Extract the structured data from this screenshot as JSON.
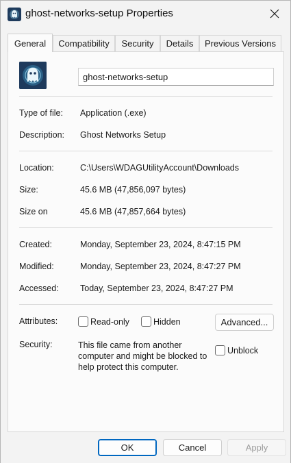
{
  "window": {
    "title": "ghost-networks-setup Properties",
    "close_glyph": "✕"
  },
  "tabs": [
    {
      "label": "General",
      "active": true
    },
    {
      "label": "Compatibility"
    },
    {
      "label": "Security"
    },
    {
      "label": "Details"
    },
    {
      "label": "Previous Versions"
    }
  ],
  "general": {
    "file_name": "ghost-networks-setup",
    "type_label": "Type of file:",
    "type_value": "Application (.exe)",
    "description_label": "Description:",
    "description_value": "Ghost Networks Setup",
    "location_label": "Location:",
    "location_value": "C:\\Users\\WDAGUtilityAccount\\Downloads",
    "size_label": "Size:",
    "size_value": "45.6 MB (47,856,097 bytes)",
    "size_on_label": "Size on",
    "size_on_value": "45.6 MB (47,857,664 bytes)",
    "created_label": "Created:",
    "created_value": "Monday, September 23, 2024, 8:47:15 PM",
    "modified_label": "Modified:",
    "modified_value": "Monday, September 23, 2024, 8:47:27 PM",
    "accessed_label": "Accessed:",
    "accessed_value": "Today, September 23, 2024, 8:47:27 PM",
    "attributes_label": "Attributes:",
    "readonly_label": "Read-only",
    "hidden_label": "Hidden",
    "advanced_label": "Advanced...",
    "security_label": "Security:",
    "security_text": "This file came from another computer and might be blocked to help protect this computer.",
    "unblock_label": "Unblock"
  },
  "footer": {
    "ok_label": "OK",
    "cancel_label": "Cancel",
    "apply_label": "Apply"
  },
  "colors": {
    "accent": "#0067c0",
    "icon_bg": "#1e3a5c"
  },
  "icons": {
    "app": "ghost-app-icon",
    "close": "close-icon"
  }
}
